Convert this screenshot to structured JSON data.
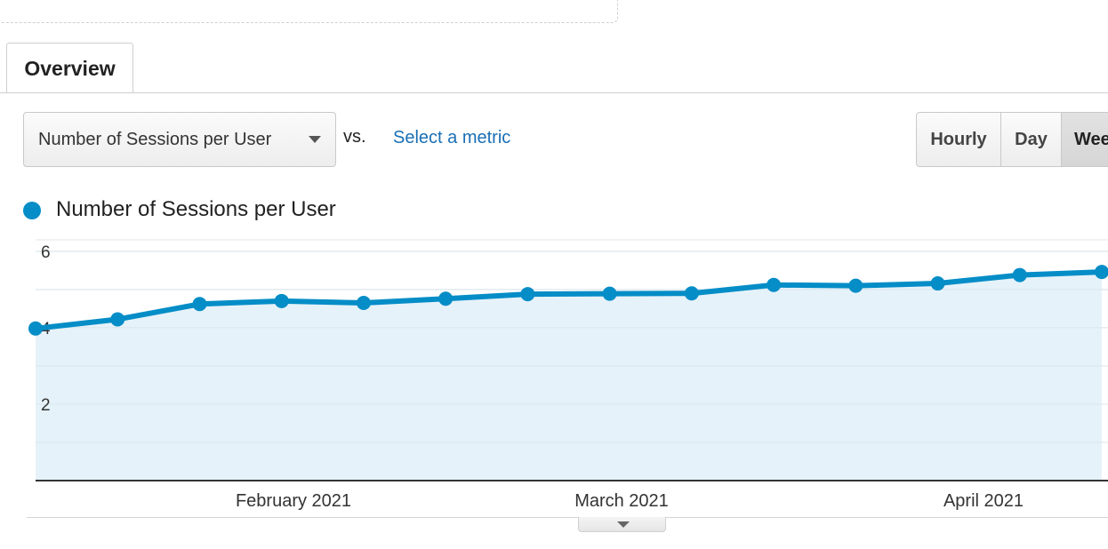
{
  "tabs": {
    "overview_label": "Overview"
  },
  "controls": {
    "metric_select_value": "Number of Sessions per User",
    "vs_label": "vs.",
    "select_metric_link": "Select a metric",
    "granularity": {
      "hourly": "Hourly",
      "day": "Day",
      "week": "Wee",
      "selected": "Week"
    }
  },
  "legend": {
    "series_label": "Number of Sessions per User",
    "color": "#058dc7"
  },
  "chart_data": {
    "type": "area",
    "series": [
      {
        "name": "Number of Sessions per User",
        "values": [
          3.98,
          4.22,
          4.62,
          4.7,
          4.65,
          4.76,
          4.88,
          4.89,
          4.9,
          5.12,
          5.1,
          5.16,
          5.38,
          5.46
        ]
      }
    ],
    "y_ticks": [
      "6",
      "4",
      "2"
    ],
    "ylim": [
      0,
      6.3
    ],
    "x_month_labels": [
      "February 2021",
      "March 2021",
      "April 2021"
    ],
    "grid": true,
    "colors": {
      "line": "#058dc7",
      "fill": "#e6f2f9"
    }
  }
}
